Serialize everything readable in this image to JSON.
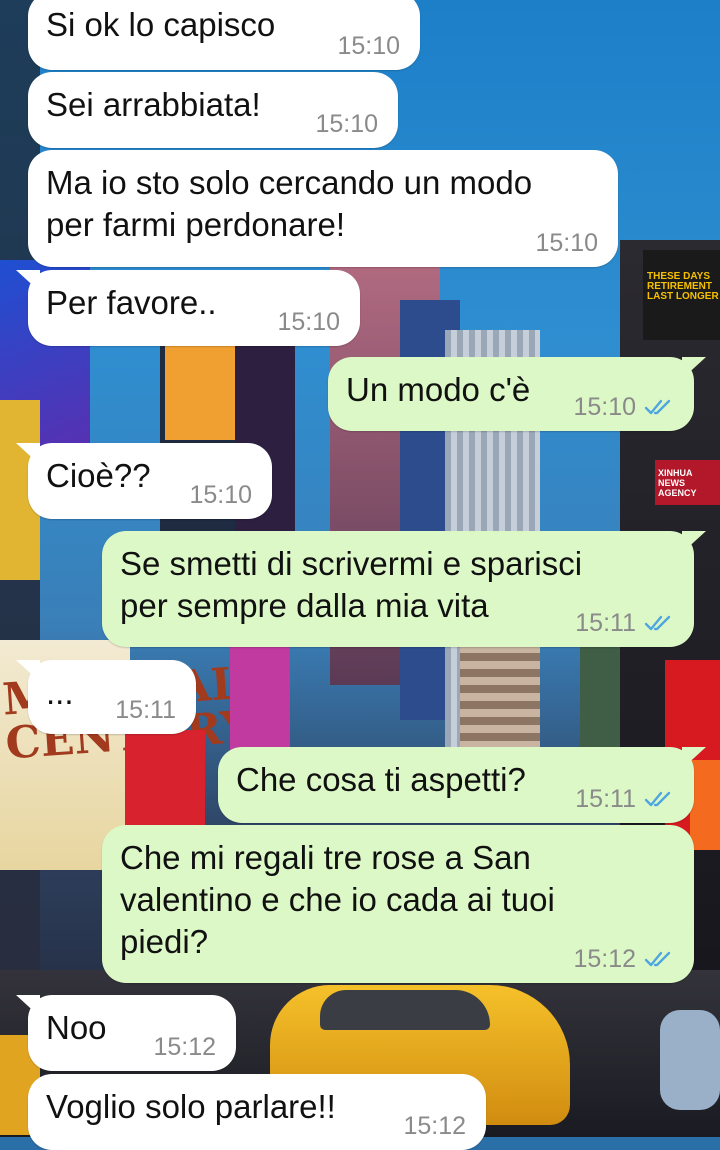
{
  "messages": [
    {
      "dir": "in",
      "text": "Si ok lo capisco",
      "time": "15:10"
    },
    {
      "dir": "in",
      "text": "Sei arrabbiata!",
      "time": "15:10"
    },
    {
      "dir": "in",
      "text": "Ma io sto solo cercando un modo\nper farmi perdonare!",
      "time": "15:10"
    },
    {
      "dir": "in",
      "text": "Per favore..",
      "time": "15:10"
    },
    {
      "dir": "out",
      "text": "Un modo c'è",
      "time": "15:10",
      "status": "read"
    },
    {
      "dir": "in",
      "text": "Cioè??",
      "time": "15:10"
    },
    {
      "dir": "out",
      "text": "Se smetti di scrivermi e sparisci\nper sempre dalla mia vita",
      "time": "15:11",
      "status": "read"
    },
    {
      "dir": "in",
      "text": "...",
      "time": "15:11"
    },
    {
      "dir": "out",
      "text": "Che cosa ti aspetti?",
      "time": "15:11",
      "status": "read"
    },
    {
      "dir": "out",
      "text": "Che mi regali tre rose a San\nvalentino e che io cada ai tuoi\npiedi?",
      "time": "15:12",
      "status": "read"
    },
    {
      "dir": "in",
      "text": "Noo",
      "time": "15:12"
    },
    {
      "dir": "in",
      "text": "Voglio solo parlare!!",
      "time": "15:12"
    }
  ],
  "wallpaper": {
    "sign_retirement": "THESE DAYS RETIREMENT LAST LONGER",
    "sign_musical": "MUSICAL CENTURY",
    "sign_xinhua": "XINHUA NEWS AGENCY"
  },
  "colors": {
    "incoming_bubble": "#ffffff",
    "outgoing_bubble": "#dcf8c6",
    "timestamp": "#8a8a8a",
    "read_ticks": "#4fa6e0"
  }
}
